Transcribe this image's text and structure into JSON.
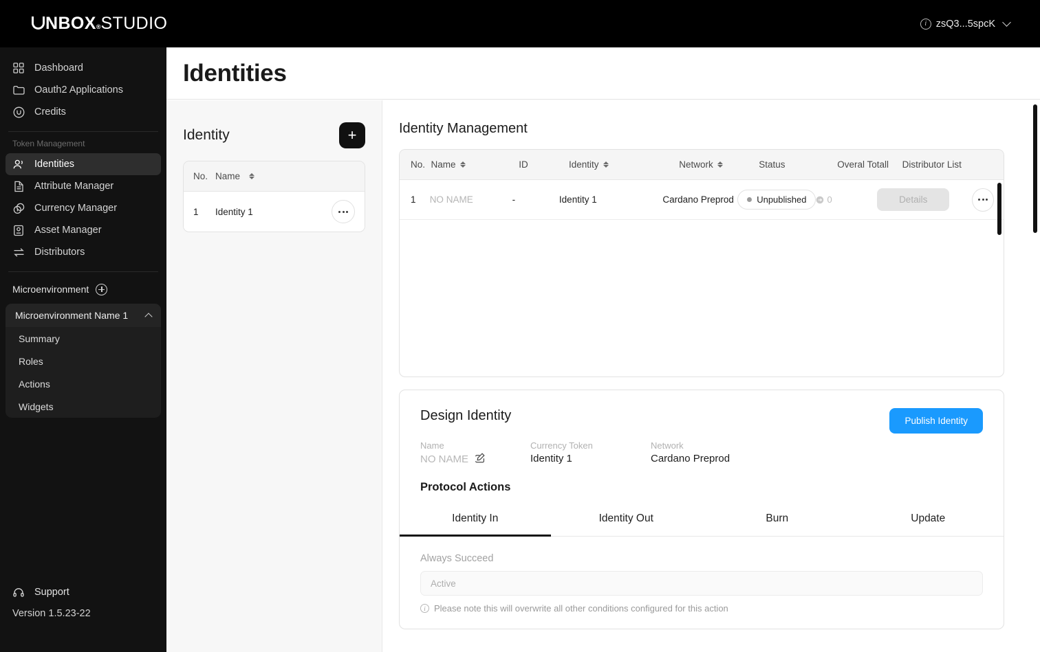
{
  "brand": {
    "name_bold": "NBOX",
    "name_sup": "®",
    "name_reg": "STUDIO"
  },
  "topbar": {
    "user_label": "zsQ3...5spcK",
    "info_icon": "info-circle-icon",
    "chevron_icon": "chevron-down-icon"
  },
  "sidebar": {
    "primary_items": [
      {
        "label": "Dashboard",
        "icon": "grid-icon"
      },
      {
        "label": "Oauth2 Applications",
        "icon": "folder-icon"
      },
      {
        "label": "Credits",
        "icon": "credits-circle-icon"
      }
    ],
    "group_label": "Token Management",
    "token_items": [
      {
        "label": "Identities",
        "icon": "users-icon",
        "active": true
      },
      {
        "label": "Attribute Manager",
        "icon": "document-icon",
        "active": false
      },
      {
        "label": "Currency Manager",
        "icon": "coins-icon",
        "active": false
      },
      {
        "label": "Asset Manager",
        "icon": "asset-icon",
        "active": false
      },
      {
        "label": "Distributors",
        "icon": "transfer-icon",
        "active": false
      }
    ],
    "microenvironment_label": "Microenvironment",
    "microenvironment_add_icon": "plus-circle-icon",
    "microenvironment_name": "Microenvironment Name 1",
    "microenvironment_chevron": "chevron-up-icon",
    "microenvironment_items": [
      {
        "label": "Summary"
      },
      {
        "label": "Roles"
      },
      {
        "label": "Actions"
      },
      {
        "label": "Widgets"
      }
    ],
    "support_label": "Support",
    "support_icon": "headset-icon",
    "version_label": "Version 1.5.23-22"
  },
  "page": {
    "title": "Identities"
  },
  "identity_panel": {
    "title": "Identity",
    "add_button_label": "+",
    "columns": [
      "No.",
      "Name"
    ],
    "rows": [
      {
        "no": "1",
        "name": "Identity 1"
      }
    ],
    "row_menu_icon": "ellipsis-icon"
  },
  "identity_management": {
    "title": "Identity Management",
    "columns": [
      {
        "label": "No.",
        "sortable": false
      },
      {
        "label": "Name",
        "sortable": true
      },
      {
        "label": "ID",
        "sortable": false
      },
      {
        "label": "Identity",
        "sortable": true
      },
      {
        "label": "Network",
        "sortable": true
      },
      {
        "label": "Status",
        "sortable": false
      },
      {
        "label": "Overal Totall",
        "sortable": false
      },
      {
        "label": "Distributor List",
        "sortable": false
      }
    ],
    "rows": [
      {
        "no": "1",
        "name": "NO NAME",
        "id": "-",
        "identity": "Identity 1",
        "network": "Cardano Preprod",
        "status": "Unpublished",
        "overall_total": "0",
        "details_label": "Details",
        "menu_icon": "ellipsis-icon"
      }
    ]
  },
  "design_identity": {
    "title": "Design Identity",
    "publish_button": "Publish Identity",
    "fields": [
      {
        "label": "Name",
        "value": "NO NAME",
        "placeholder_style": true,
        "edit_icon": "edit-pencil-icon"
      },
      {
        "label": "Currency Token",
        "value": "Identity 1",
        "placeholder_style": false
      },
      {
        "label": "Network",
        "value": "Cardano Preprod",
        "placeholder_style": false
      }
    ],
    "protocol_actions_title": "Protocol Actions",
    "tabs": [
      {
        "label": "Identity In",
        "active": true
      },
      {
        "label": "Identity Out",
        "active": false
      },
      {
        "label": "Burn",
        "active": false
      },
      {
        "label": "Update",
        "active": false
      }
    ],
    "form": {
      "field_label": "Always Succeed",
      "field_value": "Active",
      "note": "Please note this will overwrite all other conditions configured for this action",
      "note_icon": "info-circle-icon"
    }
  },
  "colors": {
    "topbar_bg": "#000000",
    "sidebar_bg": "#121212",
    "accent_blue": "#1a9afe",
    "panel_bg": "#f7f7f7",
    "scrollbar": "#111111"
  }
}
